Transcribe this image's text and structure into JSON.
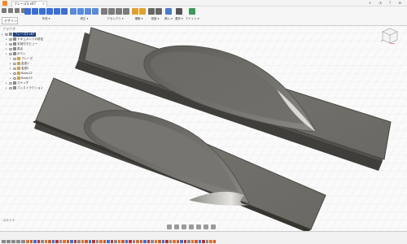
{
  "titlebar": {
    "tab_label": "フレーズ3 v67",
    "app_icon": "fusion-logo-icon"
  },
  "toolbar": {
    "workspace_label": "デザイン ▾",
    "groups": [
      {
        "label": "作成 ▾",
        "icons": [
          "#3b6fd4",
          "#3b6fd4",
          "#3b6fd4",
          "#3b6fd4",
          "#3b6fd4",
          "#3b6fd4"
        ]
      },
      {
        "label": "修正 ▾",
        "icons": [
          "#5a8ad8",
          "#5a8ad8",
          "#5a8ad8",
          "#5a8ad8"
        ]
      },
      {
        "label": "アセンブリ ▾",
        "icons": [
          "#7b7b7b",
          "#7b7b7b",
          "#7b7b7b",
          "#7b7b7b"
        ]
      },
      {
        "label": "構築 ▾",
        "icons": [
          "#e0a030",
          "#e0a030"
        ]
      },
      {
        "label": "検査 ▾",
        "icons": [
          "#666666",
          "#666666"
        ]
      },
      {
        "label": "挿入 ▾",
        "icons": [
          "#4a7bc4"
        ]
      },
      {
        "label": "選択 ▾",
        "icons": [
          "#555555"
        ]
      },
      {
        "label": "アドイン ▾",
        "icons": [
          "#3a9a5a"
        ]
      }
    ]
  },
  "browser": {
    "header": "ブラウザ",
    "rows": [
      {
        "indent": 0,
        "label": "フレーズ3 v67",
        "active": true
      },
      {
        "indent": 1,
        "label": "ドキュメントの設定",
        "active": false
      },
      {
        "indent": 1,
        "label": "名前付きビュー",
        "active": false
      },
      {
        "indent": 1,
        "label": "原点",
        "active": false
      },
      {
        "indent": 1,
        "label": "ボディ",
        "active": false
      },
      {
        "indent": 2,
        "label": "フレーズ",
        "active": false
      },
      {
        "indent": 2,
        "label": "金型1",
        "active": false
      },
      {
        "indent": 2,
        "label": "金型2",
        "active": false
      },
      {
        "indent": 2,
        "label": "Body12",
        "active": false
      },
      {
        "indent": 2,
        "label": "Body13",
        "active": false
      },
      {
        "indent": 1,
        "label": "スケッチ",
        "active": false
      },
      {
        "indent": 1,
        "label": "コンストラクション",
        "active": false
      }
    ]
  },
  "comments_label": "コメント",
  "timeline_features": 52,
  "colors": {
    "mold_face": "#75736d",
    "mold_top": "#6f6d67",
    "mold_edge": "#4a4945",
    "grid": "#d8d8d8",
    "active_doc": "#1d3c78"
  }
}
